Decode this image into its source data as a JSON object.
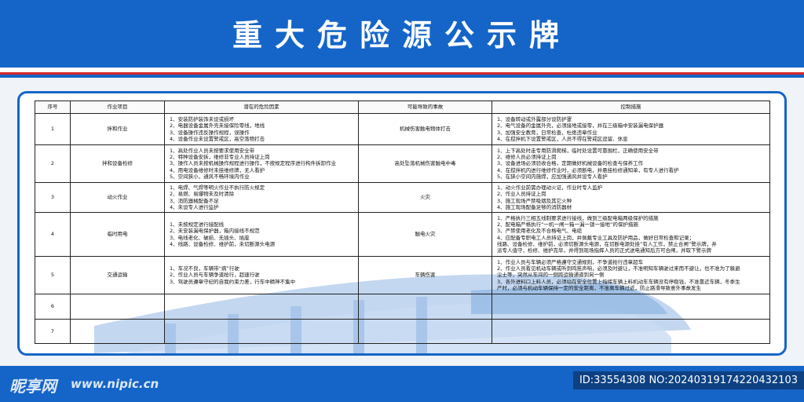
{
  "title": "重大危险源公示牌",
  "table": {
    "headers": [
      "序号",
      "作业项目",
      "潜在的危险因素",
      "可能导致的事故",
      "控制措施"
    ],
    "rows": [
      {
        "no": "1",
        "item": "拌和作业",
        "hazards": [
          "1、安装防护装饰未设或损坏",
          "2、电器设备金属外壳未接保险零线，地线",
          "3、设备操作违反操作规程，误操作",
          "4、设备作业未设置警戒区，高空落物打击"
        ],
        "accident": "机械伤害触电物体打击",
        "measures": [
          "1、设备转动或外露部分设防护罩",
          "2、电气设备的金属外壳，必须接地或接零，并在三级箱中安装漏电保护器",
          "3、加强安全教育，日常检查，杜绝违章作业",
          "4、在搅拌机下设置警戒区，人员不得在警戒区逗留、休息"
        ]
      },
      {
        "no": "2",
        "item": "拌和设备检修",
        "hazards": [
          "1、高处作业人员未按要求使用安全带",
          "2、特种设备安拆，维修非专业人员持证上岗",
          "3、操作人员未按机械操作规程进行操作，不按规定程序进行构件拆卸作业",
          "4、用电设备维修时未挂维修牌，无人看护",
          "5、空间狭小，通风不畅环境内作业"
        ],
        "accident": "高处坠落机械伤害触电中毒",
        "measures": [
          "1、上下高处时走专用防滑爬梯，临时处设置可靠围栏，正确使用安全带",
          "2、维修人员必须持证上岗",
          "3、设备进场必须验收合格，定期做好机械设备的检查与保养工作",
          "4、在搅拌机内进行维修作业时，必须断电，并悬挂检修通知单，有专人进行看护",
          "5、在狭小空间内施焊，应加强通风并设专人看护"
        ]
      },
      {
        "no": "3",
        "item": "动火作业",
        "hazards": [
          "1、电焊、气焊等明火作业不执行防火规定",
          "2、易燃、易爆物未及时清除",
          "3、消防器械配备不足",
          "4、未设专人进行监护"
        ],
        "accident": "火灾",
        "measures": [
          "1、动火作业前需办理动火证，作业时专人监护",
          "2、作业人员持证上岗",
          "3、施工现场严禁吸烟及其它火种",
          "4、施工现场配备足够的消防器材"
        ]
      },
      {
        "no": "4",
        "item": "临时用电",
        "hazards": [
          "1、未按规定进行接配线",
          "2、未安装漏电保护器，箱内接线不规范",
          "3、电线老化、破损、无插头、插座",
          "4、线路、设备检修、维护前，未切断源头电源"
        ],
        "accident": "触电火灾",
        "measures": [
          "1、严格执行三相五线制要求进行接线，做到三级配电箱两级保护的措施",
          "2、配电箱严格执行“一机一闸一箱一漏一锁一接地”的保护措施",
          "3、严禁使用老化及不合格电气、电缆",
          "4、应配备专职电工人员持证上岗，并佩戴专业工具及防护用品，做好日常检查和记录；",
          "线路、设备检修、维护前，必须切断源头电源，在切断电源处挂“有人工作，禁止合闸”警示牌，并",
          "派专人值守，检修、维护完毕，并得到现场指挥人员的正式送电通知后方可合闸，并取下警示牌"
        ]
      },
      {
        "no": "5",
        "item": "交通运输",
        "hazards": [
          "1、车况不良，车辆带“病”行驶",
          "2、作业人员与车辆争道抢行，超速行驶",
          "3、驾驶员遵章守纪的自我约束力差，行车中精神不集中"
        ],
        "accident": "车辆伤害",
        "measures": [
          "1、作业人员与车辆必须严格遵守交通规则，不争道抢行违章超车",
          "2、作业人员看见机动车辆或听到鸣笛声响，必须及时避让，不准明知车辆驶过来而不避让，也不准为了躲避",
          "尘土等，突然从车间的一侧跨运输通道到另一侧",
          "3、各外进料口上料人员，必须站在安全位置上指挥车辆上料机动车车辆没有停稳钱，不准靠近车辆，冬季生",
          "产时，必须与机动车辆保持一定的安全距离，不准离车辆过近，防止路滑导致意外事故发生"
        ]
      },
      {
        "no": "6",
        "item": "",
        "hazards": [],
        "accident": "",
        "measures": []
      },
      {
        "no": "7",
        "item": "",
        "hazards": [],
        "accident": "",
        "measures": []
      }
    ]
  },
  "watermark": {
    "brand": "昵享网",
    "url": "www.nipic.cn",
    "id_text": "ID:33554308 NO:20240319174220432103"
  },
  "colors": {
    "brand_blue": "#1565c8",
    "accent_red": "#d6282b",
    "light_blue": "#a9c6ea"
  }
}
